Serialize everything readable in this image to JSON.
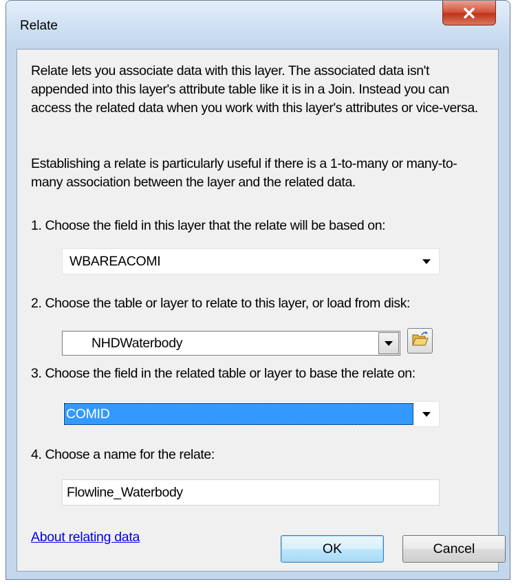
{
  "window": {
    "title": "Relate",
    "close_label": "x"
  },
  "description": {
    "paragraph1": "Relate lets you associate data with this layer. The associated data isn't appended into this layer's attribute table like it is in a Join. Instead you can access the related data when you work with this layer's attributes or vice-versa.",
    "paragraph2": "Establishing a relate is particularly useful if there is a 1-to-many or many-to-many association between the layer and the related data."
  },
  "step1": {
    "label": "1. Choose the field in this layer that the relate will be based on:",
    "value": "WBAREACOMI"
  },
  "step2": {
    "label": "2. Choose the table or layer to relate to this layer, or load from disk:",
    "value": "NHDWaterbody"
  },
  "step3": {
    "label": "3. Choose the field in the related table or layer to base the relate on:",
    "value": "COMID"
  },
  "step4": {
    "label": "4. Choose a name for the relate:",
    "value": "Flowline_Waterbody"
  },
  "footer": {
    "help_link": "About relating data",
    "ok_label": "OK",
    "cancel_label": "Cancel"
  },
  "icons": {
    "close": "close-icon",
    "dropdown": "chevron-down-icon",
    "open_folder": "open-folder-icon"
  },
  "colors": {
    "selection": "#3399ff",
    "link": "#0000ee",
    "close_button": "#c7412a"
  }
}
